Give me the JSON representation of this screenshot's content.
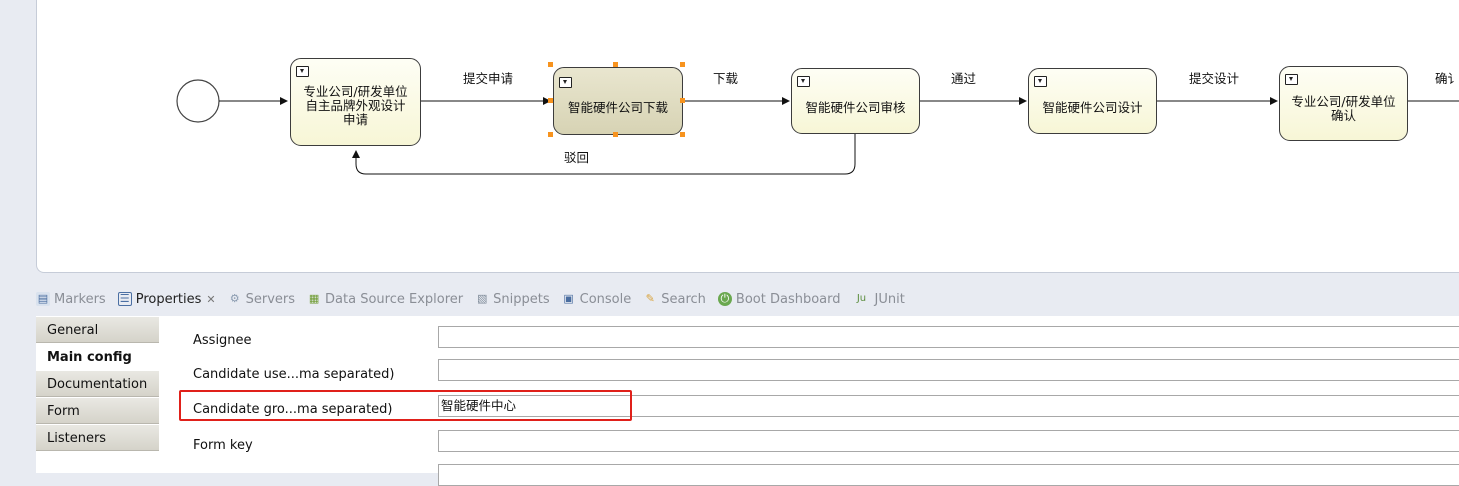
{
  "diagram": {
    "tasks": [
      {
        "id": "t1",
        "lines": [
          "专业公司/研发单位",
          "自主品牌外观设计",
          "申请"
        ]
      },
      {
        "id": "t2",
        "lines": [
          "智能硬件公司下载"
        ]
      },
      {
        "id": "t3",
        "lines": [
          "智能硬件公司审核"
        ]
      },
      {
        "id": "t4",
        "lines": [
          "智能硬件公司设计"
        ]
      },
      {
        "id": "t5",
        "lines": [
          "专业公司/研发单位",
          "确认"
        ]
      }
    ],
    "flows": {
      "submit_apply": "提交申请",
      "download": "下载",
      "pass": "通过",
      "submit_design": "提交设计",
      "confirm_partial": "确讠",
      "reject": "驳回"
    }
  },
  "tabs": [
    {
      "name": "tab-markers",
      "label": "Markers",
      "icon": "markers-icon"
    },
    {
      "name": "tab-properties",
      "label": "Properties",
      "icon": "properties-icon",
      "active": true
    },
    {
      "name": "tab-servers",
      "label": "Servers",
      "icon": "servers-icon"
    },
    {
      "name": "tab-data-source-explorer",
      "label": "Data Source Explorer",
      "icon": "database-icon"
    },
    {
      "name": "tab-snippets",
      "label": "Snippets",
      "icon": "snippets-icon"
    },
    {
      "name": "tab-console",
      "label": "Console",
      "icon": "console-icon"
    },
    {
      "name": "tab-search",
      "label": "Search",
      "icon": "search-icon"
    },
    {
      "name": "tab-boot-dashboard",
      "label": "Boot Dashboard",
      "icon": "boot-icon"
    },
    {
      "name": "tab-junit",
      "label": "JUnit",
      "icon": "junit-icon"
    }
  ],
  "properties": {
    "sections": [
      "General",
      "Main config",
      "Documentation",
      "Form",
      "Listeners"
    ],
    "active_section": "Main config",
    "fields": [
      {
        "label": "Assignee",
        "value": ""
      },
      {
        "label": "Candidate use...ma separated)",
        "value": ""
      },
      {
        "label": "Candidate gro...ma separated)",
        "value": "智能硬件中心"
      },
      {
        "label": "Form key",
        "value": ""
      },
      {
        "label": "",
        "value": ""
      }
    ]
  },
  "colors": {
    "highlight": "#e0201a",
    "selection_handle": "#f7931e",
    "task_fill": "#f7f6d6"
  }
}
